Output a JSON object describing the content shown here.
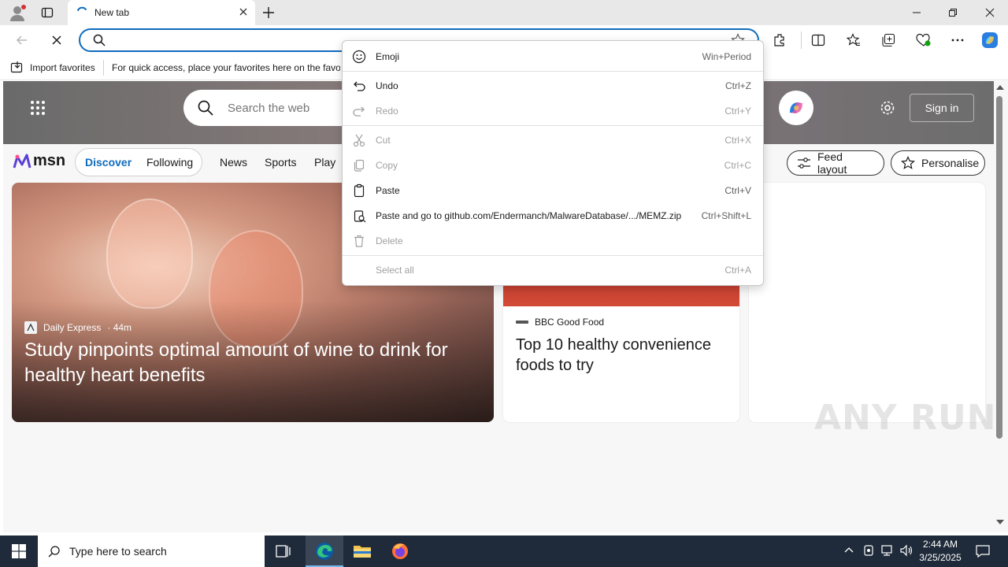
{
  "window": {
    "tab_title": "New tab",
    "colors": {
      "accent": "#0f6cbd",
      "titlebar": "#e8e8e8",
      "taskbar": "#1f2b3a"
    }
  },
  "favorites_bar": {
    "import_label": "Import favorites",
    "hint": "For quick access, place your favorites here on the favorites bar."
  },
  "msn": {
    "logo": "msn",
    "search_placeholder": "Search the web",
    "signin_label": "Sign in",
    "nav": {
      "discover": "Discover",
      "following": "Following",
      "items": [
        "News",
        "Sports",
        "Play"
      ]
    },
    "feed_layout_label": "Feed layout",
    "personalise_label": "Personalise",
    "main_story": {
      "source": "Daily Express",
      "age": "· 44m",
      "headline": "Study pinpoints optimal amount of wine to drink for healthy heart benefits"
    },
    "card2": {
      "source": "BBC Good Food",
      "title": "Top 10 healthy convenience foods to try"
    }
  },
  "context_menu": {
    "items": [
      {
        "label": "Emoji",
        "shortcut": "Win+Period",
        "enabled": true,
        "icon": "emoji-icon"
      },
      {
        "label": "Undo",
        "shortcut": "Ctrl+Z",
        "enabled": true,
        "icon": "undo-icon"
      },
      {
        "label": "Redo",
        "shortcut": "Ctrl+Y",
        "enabled": false,
        "icon": "redo-icon"
      },
      {
        "label": "Cut",
        "shortcut": "Ctrl+X",
        "enabled": false,
        "icon": "cut-icon"
      },
      {
        "label": "Copy",
        "shortcut": "Ctrl+C",
        "enabled": false,
        "icon": "copy-icon"
      },
      {
        "label": "Paste",
        "shortcut": "Ctrl+V",
        "enabled": true,
        "icon": "paste-icon"
      },
      {
        "label": "Paste and go to github.com/Endermanch/MalwareDatabase/.../MEMZ.zip",
        "shortcut": "Ctrl+Shift+L",
        "enabled": true,
        "icon": "paste-go-icon"
      },
      {
        "label": "Delete",
        "shortcut": "",
        "enabled": false,
        "icon": "delete-icon"
      },
      {
        "label": "Select all",
        "shortcut": "Ctrl+A",
        "enabled": false,
        "icon": ""
      }
    ]
  },
  "watermark": "ANY RUN",
  "taskbar": {
    "search_placeholder": "Type here to search",
    "time": "2:44 AM",
    "date": "3/25/2025"
  }
}
